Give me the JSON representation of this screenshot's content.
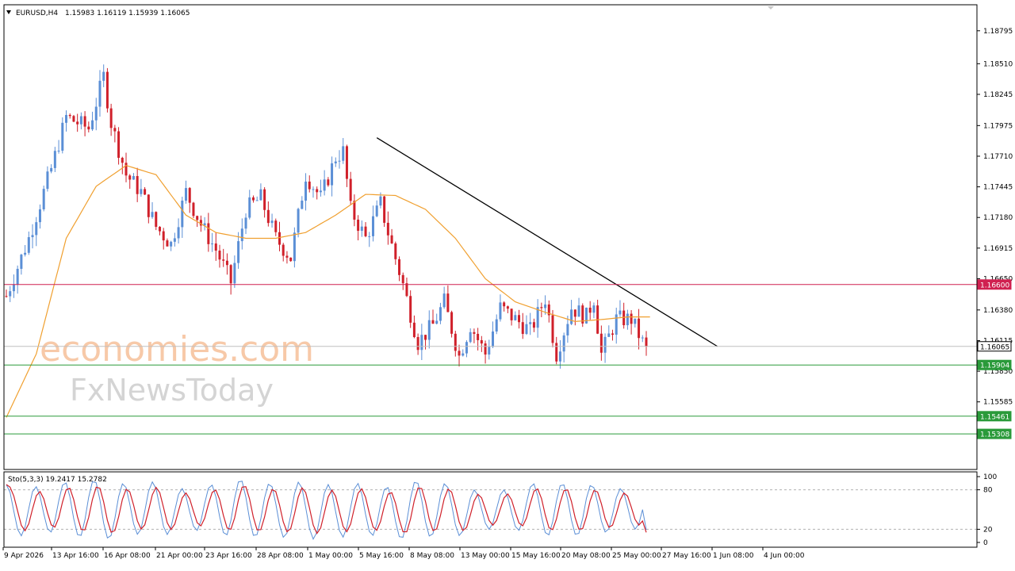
{
  "header": {
    "symbol": "EURUSD,H4",
    "ohlc": "1.15983 1.16119 1.15939 1.16065",
    "dropdown_icon": "triangle-down-icon"
  },
  "watermark": {
    "line1": "economies.com",
    "line2": "FxNewsToday"
  },
  "colors": {
    "bull": "#5b8fd6",
    "bear": "#d0202a",
    "ma": "#f0a030",
    "trendline": "#000000",
    "resistance": "#d02050",
    "support": "#2a9a3a",
    "current_price": "#c0c0c0",
    "stoch_main": "#5b8fd6",
    "stoch_signal": "#d0202a"
  },
  "chart_data": [
    {
      "type": "candlestick",
      "title": "EURUSD,H4",
      "ylim": [
        1.15,
        1.1902
      ],
      "y_ticks": [
        "1.18795",
        "1.18510",
        "1.18245",
        "1.17975",
        "1.17710",
        "1.17445",
        "1.17180",
        "1.16915",
        "1.16650",
        "1.16380",
        "1.16115",
        "1.15850",
        "1.15585"
      ],
      "x_labels": [
        "9 Apr 2026",
        "13 Apr 16:00",
        "16 Apr 08:00",
        "21 Apr 00:00",
        "23 Apr 16:00",
        "28 Apr 08:00",
        "1 May 00:00",
        "5 May 16:00",
        "8 May 08:00",
        "13 May 00:00",
        "15 May 16:00",
        "20 May 08:00",
        "25 May 00:00",
        "27 May 16:00",
        "1 Jun 08:00",
        "4 Jun 00:00"
      ],
      "close_path": [
        [
          0,
          1.165
        ],
        [
          6,
          1.17
        ],
        [
          12,
          1.176
        ],
        [
          16,
          1.1805
        ],
        [
          22,
          1.1795
        ],
        [
          26,
          1.184
        ],
        [
          28,
          1.18
        ],
        [
          32,
          1.1755
        ],
        [
          36,
          1.174
        ],
        [
          40,
          1.171
        ],
        [
          44,
          1.1695
        ],
        [
          48,
          1.174
        ],
        [
          52,
          1.1712
        ],
        [
          56,
          1.169
        ],
        [
          60,
          1.1662
        ],
        [
          64,
          1.1725
        ],
        [
          68,
          1.1735
        ],
        [
          72,
          1.17
        ],
        [
          76,
          1.1683
        ],
        [
          80,
          1.1755
        ],
        [
          84,
          1.1735
        ],
        [
          88,
          1.177
        ],
        [
          90,
          1.1775
        ],
        [
          92,
          1.1725
        ],
        [
          96,
          1.17
        ],
        [
          100,
          1.173
        ],
        [
          102,
          1.1705
        ],
        [
          106,
          1.166
        ],
        [
          110,
          1.161
        ],
        [
          114,
          1.1625
        ],
        [
          117,
          1.1645
        ],
        [
          121,
          1.1598
        ],
        [
          124,
          1.1625
        ],
        [
          128,
          1.16
        ],
        [
          132,
          1.164
        ],
        [
          136,
          1.163
        ],
        [
          140,
          1.162
        ],
        [
          144,
          1.1648
        ],
        [
          147,
          1.16
        ],
        [
          151,
          1.164
        ],
        [
          155,
          1.1632
        ],
        [
          157,
          1.1648
        ],
        [
          159,
          1.16
        ],
        [
          163,
          1.163
        ],
        [
          167,
          1.163
        ],
        [
          170,
          1.161
        ],
        [
          171,
          1.1606
        ]
      ],
      "moving_average_path": [
        [
          0,
          1.1545
        ],
        [
          8,
          1.16
        ],
        [
          16,
          1.17
        ],
        [
          24,
          1.1745
        ],
        [
          32,
          1.1763
        ],
        [
          40,
          1.1755
        ],
        [
          48,
          1.172
        ],
        [
          56,
          1.1705
        ],
        [
          64,
          1.17
        ],
        [
          72,
          1.17
        ],
        [
          80,
          1.1705
        ],
        [
          88,
          1.172
        ],
        [
          96,
          1.1738
        ],
        [
          104,
          1.1737
        ],
        [
          112,
          1.1725
        ],
        [
          120,
          1.17
        ],
        [
          128,
          1.1665
        ],
        [
          136,
          1.1645
        ],
        [
          144,
          1.1636
        ],
        [
          152,
          1.1628
        ],
        [
          160,
          1.163
        ],
        [
          166,
          1.1632
        ],
        [
          172,
          1.1632
        ]
      ],
      "trendline": {
        "from": [
          99,
          1.1787
        ],
        "to": [
          190,
          1.16065
        ]
      },
      "horizontal_levels": [
        {
          "value": 1.166,
          "label": "1.16600",
          "role": "resistance"
        },
        {
          "value": 1.16065,
          "label": "1.16065",
          "role": "current_price"
        },
        {
          "value": 1.15904,
          "label": "1.15904",
          "role": "support"
        },
        {
          "value": 1.15461,
          "label": "1.15461",
          "role": "support"
        },
        {
          "value": 1.15308,
          "label": "1.15308",
          "role": "support"
        }
      ]
    },
    {
      "type": "line",
      "title": "Sto(5,3,3) 19.2417 15.2782",
      "ylim": [
        0,
        100
      ],
      "y_ticks": [
        "100",
        "80",
        "20",
        "0"
      ],
      "levels": [
        80,
        20
      ],
      "peaks": [
        88,
        10,
        85,
        15,
        92,
        8,
        95,
        5,
        90,
        12,
        92,
        12,
        82,
        18,
        88,
        10,
        96,
        8,
        90,
        7,
        92,
        5,
        88,
        8,
        90,
        10,
        85,
        5,
        94,
        8,
        90,
        10,
        80,
        20,
        80,
        18,
        90,
        10,
        90,
        10,
        88,
        15,
        82,
        20
      ],
      "series": [
        {
          "name": "19.2417",
          "last": 19.2417
        },
        {
          "name": "15.2782",
          "last": 15.2782
        }
      ]
    }
  ]
}
